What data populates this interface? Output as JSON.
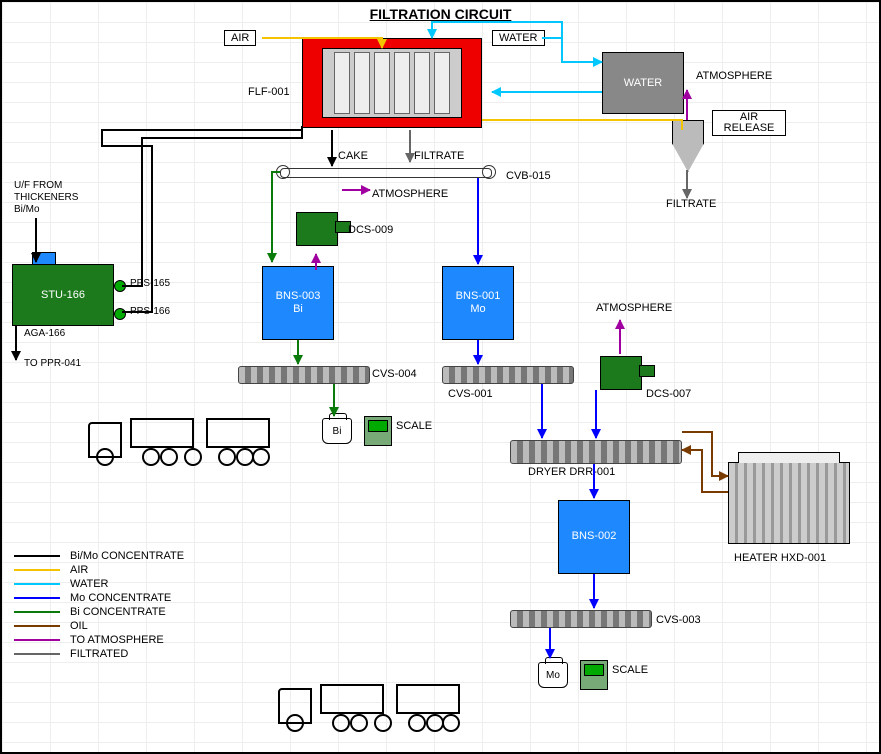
{
  "title": "FILTRATION CIRCUIT",
  "inputs": {
    "air": "AIR",
    "water_in": "WATER"
  },
  "water_tank": "WATER",
  "atmosphere": "ATMOSPHERE",
  "air_release": {
    "l1": "AIR",
    "l2": "RELEASE"
  },
  "filtrate": "FILTRATE",
  "equipment": {
    "press": "FLF-001",
    "cake": "CAKE",
    "filtrate2": "FILTRATE",
    "atm2": "ATMOSPHERE",
    "conveyor": "CVB-015",
    "dcs009": "DCS-009",
    "dcs007": "DCS-007",
    "bns003": {
      "id": "BNS-003",
      "mat": "Bi"
    },
    "bns001": {
      "id": "BNS-001",
      "mat": "Mo"
    },
    "bns002": "BNS-002",
    "cvs004": "CVS-004",
    "cvs001": "CVS-001",
    "cvs003": "CVS-003",
    "dryer": "DRYER DRR-001",
    "heater": "HEATER  HXD-001",
    "stu166": "STU-166",
    "aga166": "AGA-166",
    "pps165": "PPS-165",
    "pps166": "PPS-166",
    "to_ppr": "TO PPR-041",
    "uf_from": {
      "l1": "U/F FROM",
      "l2": "THICKENERS",
      "l3": "Bi/Mo"
    }
  },
  "scale": "SCALE",
  "sack_bi": "Bi",
  "sack_mo": "Mo",
  "legend": {
    "bimo": {
      "label": "Bi/Mo CONCENTRATE",
      "color": "#000000"
    },
    "air": {
      "label": "AIR",
      "color": "#f5c400"
    },
    "water": {
      "label": "WATER",
      "color": "#00c8ff"
    },
    "mo": {
      "label": " Mo CONCENTRATE",
      "color": "#0000ff"
    },
    "bi": {
      "label": " Bi CONCENTRATE",
      "color": "#0a7a0a"
    },
    "oil": {
      "label": "OIL",
      "color": "#7a3b00"
    },
    "atm": {
      "label": "TO ATMOSPHERE",
      "color": "#a000a0"
    },
    "filt": {
      "label": "FILTRATED",
      "color": "#666666"
    }
  }
}
